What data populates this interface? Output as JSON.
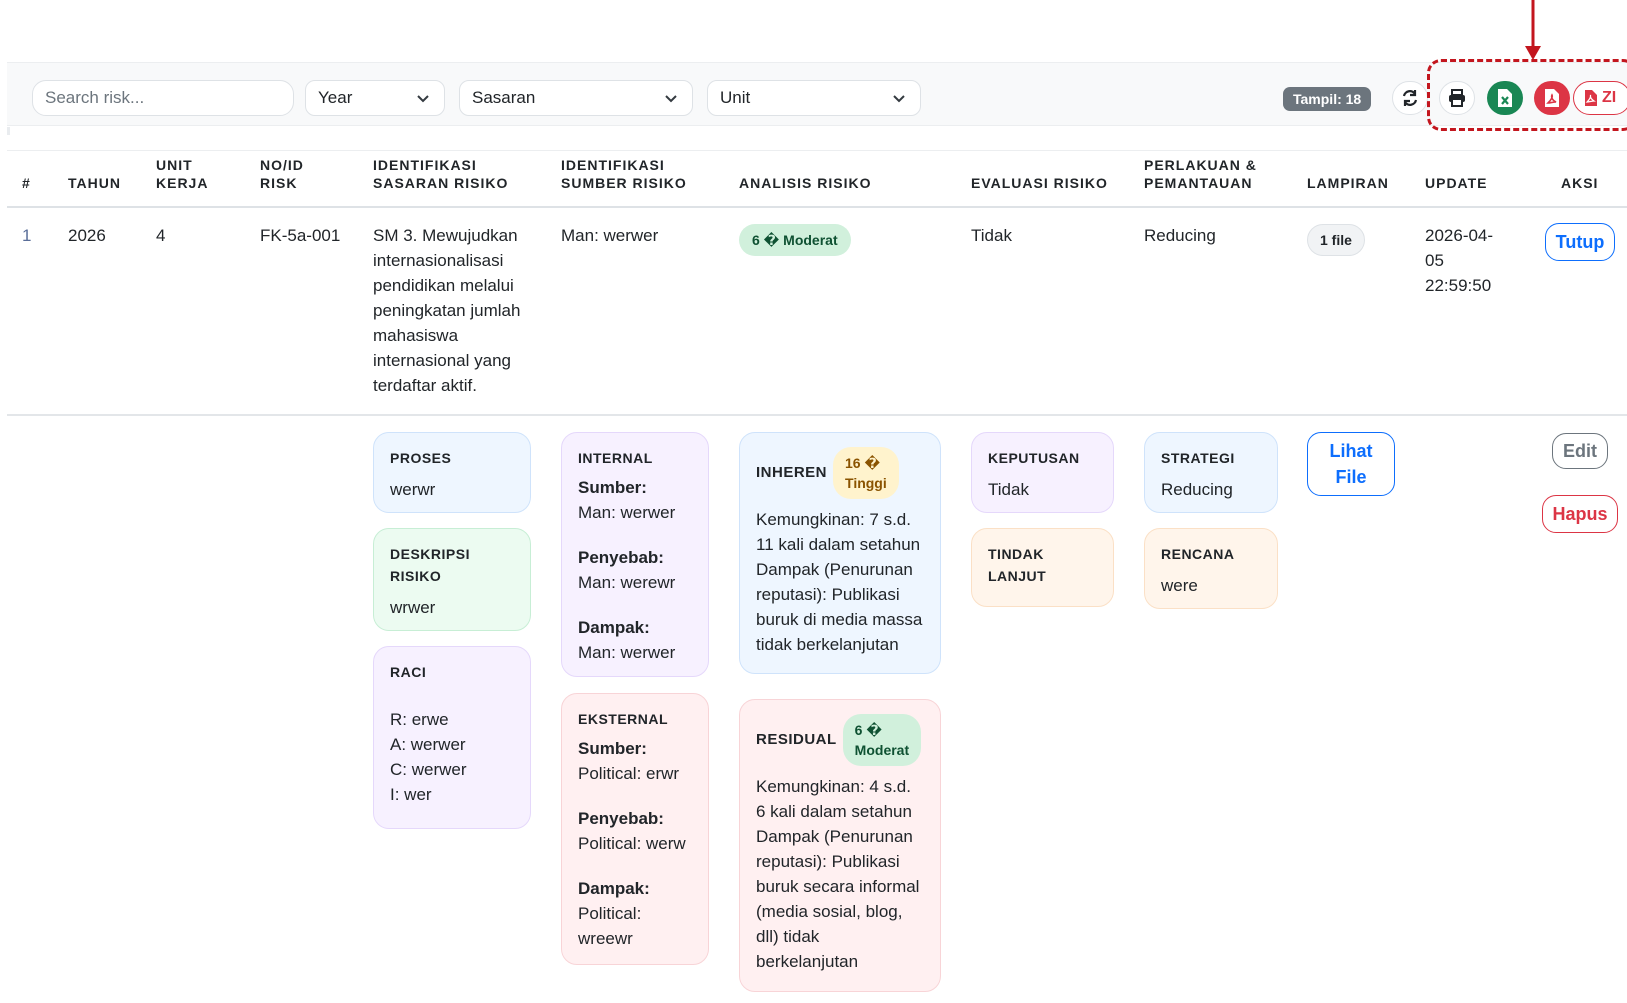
{
  "filters": {
    "search_placeholder": "Search risk...",
    "year": "Year",
    "sasaran": "Sasaran",
    "unit": "Unit",
    "count": "Tampil: 18",
    "zip_label": "ZI"
  },
  "icons": {
    "refresh": "refresh-icon",
    "print": "printer-icon",
    "excel": "file-excel-icon",
    "pdf": "file-pdf-icon",
    "zip": "file-zip-icon"
  },
  "colors": {
    "primary": "#0d6efd",
    "success": "#198754",
    "danger": "#dc3545",
    "annotation": "#c3161e"
  },
  "table": {
    "headers": [
      "#",
      "TAHUN",
      "UNIT\nKERJA",
      "NO/ID\nRISK",
      "IDENTIFIKASI\nSASARAN RISIKO",
      "IDENTIFIKASI\nSUMBER RISIKO",
      "ANALISIS RISIKO",
      "EVALUASI RISIKO",
      "PERLAKUAN &\nPEMANTAUAN",
      "LAMPIRAN",
      "UPDATE",
      "AKSI"
    ],
    "row": {
      "num": "1",
      "tahun": "2026",
      "unit": "4",
      "id": "FK-5a-001",
      "sasaran": "SM 3. Mewujudkan internasionalisasi pendidikan melalui peningkatan jumlah mahasiswa internasional yang terdaftar aktif.",
      "sumber": "Man: werwer",
      "analisis_score": "6 �",
      "analisis_level": "Moderat",
      "evaluasi": "Tidak",
      "perlakuan": "Reducing",
      "lampiran": "1 file",
      "update_date": "2026-04-",
      "update_date2": "05",
      "update_time": "22:59:50",
      "aksi": "Tutup"
    },
    "detail": {
      "proses": {
        "title": "PROSES",
        "value": "werwr"
      },
      "deskripsi": {
        "title": "DESKRIPSI\nRISIKO",
        "value": "wrwer"
      },
      "raci": {
        "title": "RACI",
        "r": "R: erwe",
        "a": "A: werwer",
        "c": "C: werwer",
        "i": "I: wer"
      },
      "internal": {
        "title": "INTERNAL",
        "sumber_label": "Sumber:",
        "sumber": "Man: werwer",
        "penyebab_label": "Penyebab:",
        "penyebab": "Man: werewr",
        "dampak_label": "Dampak:",
        "dampak": "Man: werwer"
      },
      "eksternal": {
        "title": "EKSTERNAL",
        "sumber_label": "Sumber:",
        "sumber": "Political: erwr",
        "penyebab_label": "Penyebab:",
        "penyebab": "Political: werw",
        "dampak_label": "Dampak:",
        "dampak": "Political:\nwreewr"
      },
      "inheren": {
        "title": "INHEREN",
        "score": "16 �",
        "level": "Tinggi",
        "text": "Kemungkinan: 7 s.d. 11 kali dalam setahun Dampak (Penurunan reputasi): Publikasi buruk di media massa tidak berkelanjutan"
      },
      "residual": {
        "title": "RESIDUAL",
        "score": "6 �",
        "level": "Moderat",
        "text": "Kemungkinan: 4 s.d. 6 kali dalam setahun Dampak (Penurunan reputasi): Publikasi buruk secara informal (media sosial, blog, dll) tidak berkelanjutan"
      },
      "keputusan": {
        "title": "KEPUTUSAN",
        "value": "Tidak"
      },
      "tindak_lanjut": {
        "title": "TINDAK\nLANJUT",
        "value": ""
      },
      "strategi": {
        "title": "STRATEGI",
        "value": "Reducing"
      },
      "rencana": {
        "title": "RENCANA",
        "value": "were"
      },
      "lihat_file": "Lihat\nFile",
      "edit": "Edit",
      "hapus": "Hapus"
    }
  }
}
